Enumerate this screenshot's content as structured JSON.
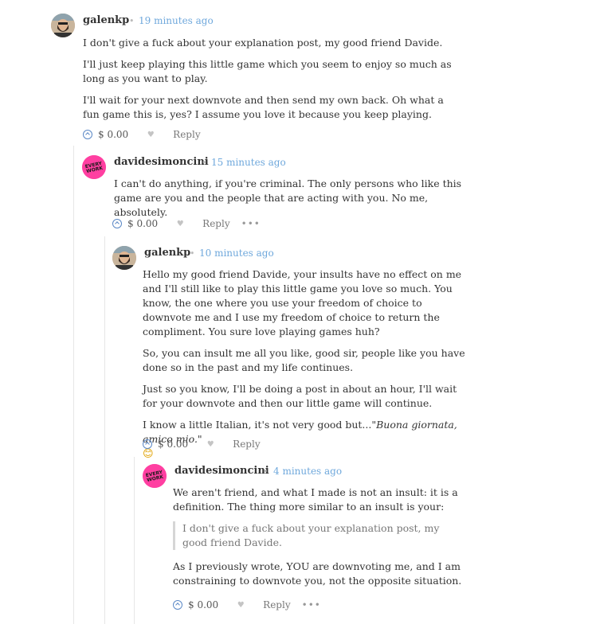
{
  "comments": [
    {
      "author": "galenkp",
      "time": "19 minutes ago",
      "paragraphs": [
        "I don't give a fuck about your explanation post, my good friend Davide.",
        "I'll just keep playing this little game which you seem to enjoy so much as long as you want to play.",
        "I'll wait for your next downvote and then send my own back. Oh what a fun game this is, yes? I assume you love it because you keep playing."
      ],
      "payout": "$ 0.00",
      "reply_label": "Reply"
    },
    {
      "author": "davidesimoncini",
      "time": "15 minutes ago",
      "avatar_text": "EVERY WORK",
      "paragraphs": [
        "I can't do anything, if you're criminal. The only persons who like this game are you and the people that are acting with you. No me, absolutely."
      ],
      "payout": "$ 0.00",
      "reply_label": "Reply",
      "more": "•••"
    },
    {
      "author": "galenkp",
      "time": "10 minutes ago",
      "paragraphs": [
        "Hello my good friend Davide, your insults have no effect on me and I'll still like to play this little game you love so much. You know, the one where you use your freedom of choice to downvote me and I use my freedom of choice to return the compliment. You sure love playing games huh?",
        "So, you can insult me all you like, good sir, people like you have done so in the past and my life continues.",
        "Just so you know, I'll be doing a post in about an hour, I'll wait for your downvote and then our little game will continue."
      ],
      "last_para_prefix": "I know a little Italian, it's not very good but...",
      "last_para_italic": "\"Buona giornata, amico mio.\"",
      "emoji": "😊",
      "payout": "$ 0.00",
      "reply_label": "Reply"
    },
    {
      "author": "davidesimoncini",
      "time": "4 minutes ago",
      "avatar_text": "EVERY WORK",
      "paragraphs": [
        "We aren't friend, and what I made is not an insult: it is a definition. The thing more similar to an insult is your:"
      ],
      "quote": "I don't give a fuck about your explanation post, my good friend Davide.",
      "paragraphs_after": [
        "As I previously wrote, YOU are downvoting me, and I am constraining to downvote you, not the opposite situation."
      ],
      "payout": "$ 0.00",
      "reply_label": "Reply",
      "more": "•••"
    }
  ],
  "colors": {
    "time": "#6fa8dc",
    "vote": "#5b88c6",
    "avatar_davide": "#ff3fa1"
  }
}
